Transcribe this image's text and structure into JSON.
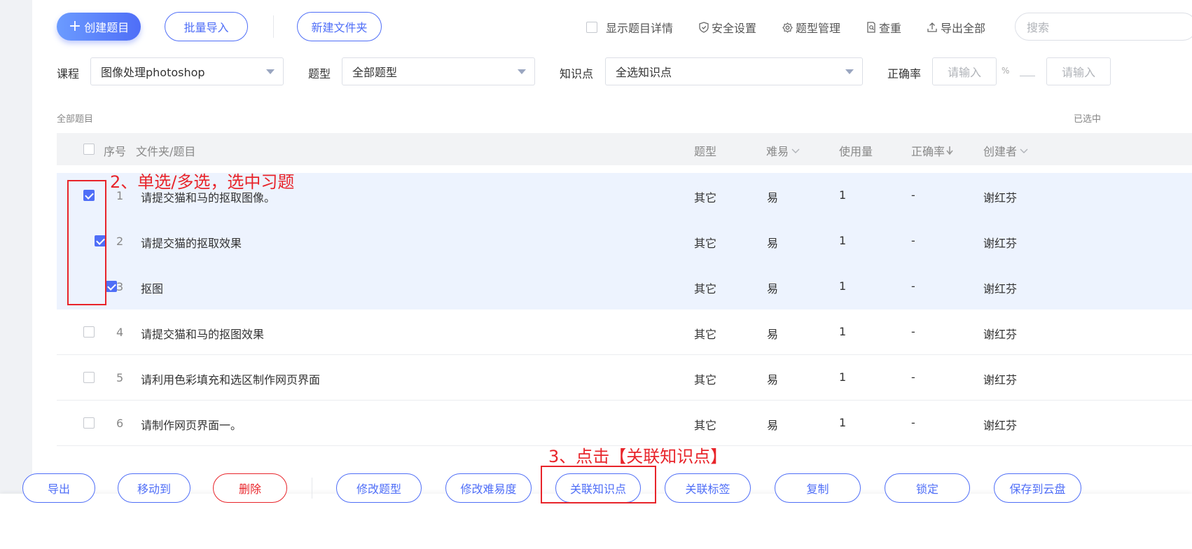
{
  "toolbar": {
    "create_label": "创建题目",
    "batch_import_label": "批量导入",
    "new_folder_label": "新建文件夹",
    "show_detail_label": "显示题目详情",
    "security_label": "安全设置",
    "type_manage_label": "题型管理",
    "dedup_label": "查重",
    "export_all_label": "导出全部",
    "search_placeholder": "搜索"
  },
  "filters": {
    "course_label": "课程",
    "course_value": "图像处理photoshop",
    "type_label": "题型",
    "type_value": "全部题型",
    "knowledge_label": "知识点",
    "knowledge_value": "全选知识点",
    "accuracy_label": "正确率",
    "accuracy_min_placeholder": "请输入",
    "percent_sign": "%",
    "accuracy_max_placeholder": "请输入"
  },
  "list": {
    "all_label": "全部题目",
    "selected_label": "已选中"
  },
  "table": {
    "headers": {
      "index": "序号",
      "title": "文件夹/题目",
      "type": "题型",
      "difficulty": "难易",
      "usage": "使用量",
      "accuracy": "正确率",
      "creator": "创建者"
    },
    "rows": [
      {
        "index": "1",
        "title": "请提交猫和马的抠取图像。",
        "type": "其它",
        "difficulty": "易",
        "usage": "1",
        "accuracy": "-",
        "creator": "谢红芬",
        "checked": true
      },
      {
        "index": "2",
        "title": "请提交猫的抠取效果",
        "type": "其它",
        "difficulty": "易",
        "usage": "1",
        "accuracy": "-",
        "creator": "谢红芬",
        "checked": true
      },
      {
        "index": "3",
        "title": "抠图",
        "type": "其它",
        "difficulty": "易",
        "usage": "1",
        "accuracy": "-",
        "creator": "谢红芬",
        "checked": true
      },
      {
        "index": "4",
        "title": "请提交猫和马的抠图效果",
        "type": "其它",
        "difficulty": "易",
        "usage": "1",
        "accuracy": "-",
        "creator": "谢红芬",
        "checked": false
      },
      {
        "index": "5",
        "title": "请利用色彩填充和选区制作网页界面",
        "type": "其它",
        "difficulty": "易",
        "usage": "1",
        "accuracy": "-",
        "creator": "谢红芬",
        "checked": false
      },
      {
        "index": "6",
        "title": "请制作网页界面一。",
        "type": "其它",
        "difficulty": "易",
        "usage": "1",
        "accuracy": "-",
        "creator": "谢红芬",
        "checked": false
      }
    ]
  },
  "annotations": {
    "step2": "2、单选/多选，选中习题",
    "step3": "3、点击【关联知识点】"
  },
  "bottom_bar": {
    "export": "导出",
    "move_to": "移动到",
    "delete": "删除",
    "modify_type": "修改题型",
    "modify_difficulty": "修改难易度",
    "link_knowledge": "关联知识点",
    "link_tag": "关联标签",
    "copy": "复制",
    "lock": "锁定",
    "save_cloud": "保存到云盘"
  },
  "colors": {
    "accent": "#4f6ef7",
    "annotation": "#e8242a",
    "selected_row_bg": "#edf3fe"
  }
}
